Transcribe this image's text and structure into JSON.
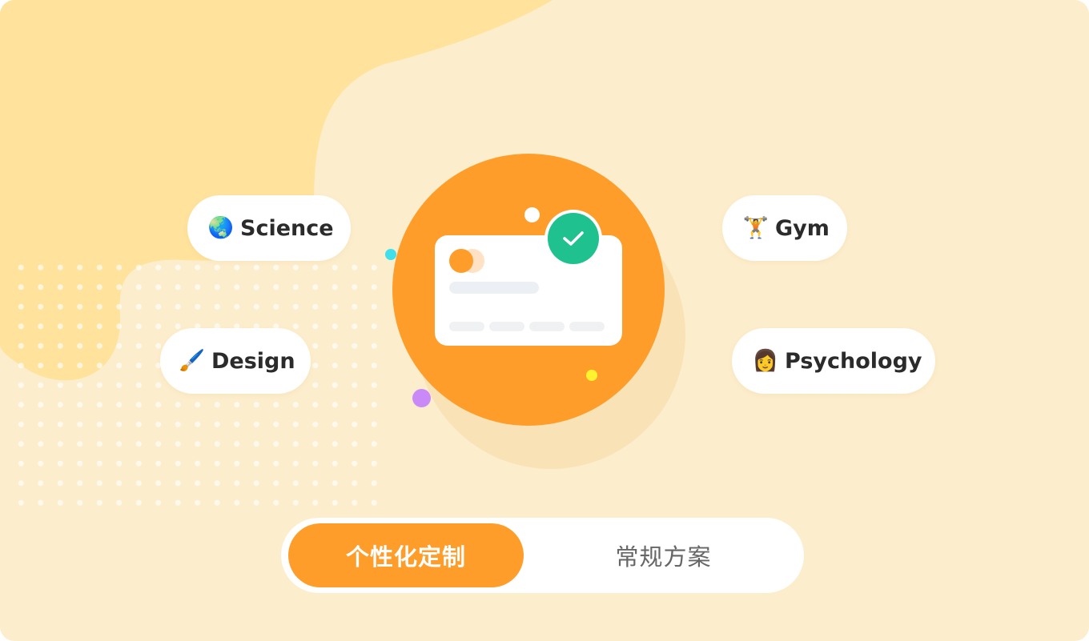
{
  "colors": {
    "background": "#fcedcc",
    "blob": "#ffe29c",
    "accent": "#ff9d2b",
    "check": "#1fc28e",
    "pill": "#ffffff"
  },
  "tags": [
    {
      "emoji": "🌏",
      "label": "Science",
      "icon": "globe-icon"
    },
    {
      "emoji": "🖌️",
      "label": "Design",
      "icon": "paintbrush-icon"
    },
    {
      "emoji": "🏋️",
      "label": "Gym",
      "icon": "weightlifter-icon"
    },
    {
      "emoji": "👩",
      "label": "Psychology",
      "icon": "woman-icon"
    }
  ],
  "toggle": {
    "options": [
      "个性化定制",
      "常规方案"
    ],
    "selected": "个性化定制"
  }
}
